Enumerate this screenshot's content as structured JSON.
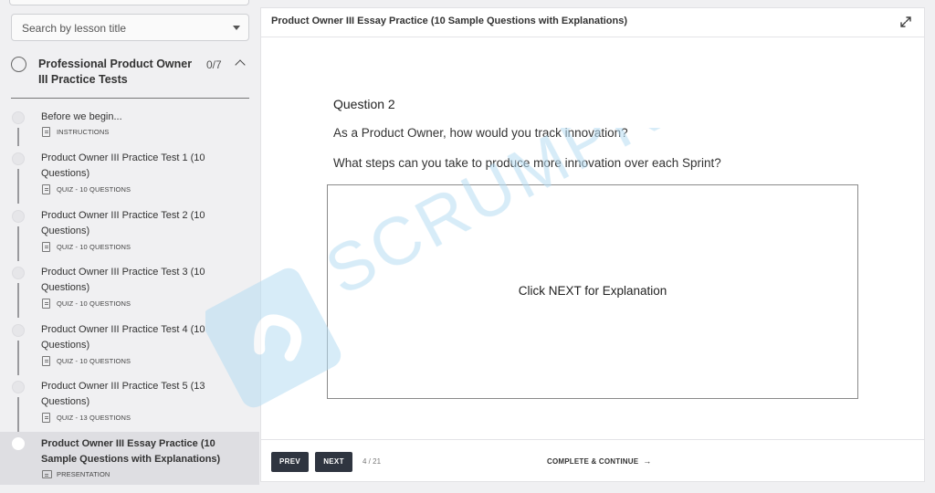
{
  "sidebar": {
    "search": {
      "placeholder": "Search by lesson title"
    },
    "section": {
      "title": "Professional Product Owner III Practice Tests",
      "count": "0/7"
    },
    "lessons": [
      {
        "title": "Before we begin...",
        "meta": "INSTRUCTIONS",
        "type": "doc"
      },
      {
        "title": "Product Owner III Practice Test 1 (10 Questions)",
        "meta": "QUIZ - 10 QUESTIONS",
        "type": "quiz"
      },
      {
        "title": "Product Owner III Practice Test 2 (10 Questions)",
        "meta": "QUIZ - 10 QUESTIONS",
        "type": "quiz"
      },
      {
        "title": "Product Owner III Practice Test 3 (10 Questions)",
        "meta": "QUIZ - 10 QUESTIONS",
        "type": "quiz"
      },
      {
        "title": "Product Owner III Practice Test 4 (10 Questions)",
        "meta": "QUIZ - 10 QUESTIONS",
        "type": "quiz"
      },
      {
        "title": "Product Owner III Practice Test 5 (13 Questions)",
        "meta": "QUIZ - 13 QUESTIONS",
        "type": "quiz"
      },
      {
        "title": "Product Owner III Essay Practice (10 Sample Questions with Explanations)",
        "meta": "PRESENTATION",
        "type": "presentation"
      }
    ]
  },
  "main": {
    "title": "Product Owner III Essay Practice (10 Sample Questions with Explanations)",
    "question": {
      "number": "Question 2",
      "line1": "As a Product Owner, how would you track innovation?",
      "line2": "What steps can you take to produce more innovation over each Sprint?"
    },
    "answer_box_text": "Click NEXT for Explanation",
    "watermark": "SCRUMPREP",
    "footer": {
      "prev_label": "PREV",
      "next_label": "NEXT",
      "page": "4 / 21",
      "complete_label": "COMPLETE & CONTINUE",
      "complete_arrow": "→"
    }
  },
  "colors": {
    "button_bg": "#2f3540",
    "watermark": "#b6dcf2",
    "active_lesson_bg": "#dedee2"
  }
}
